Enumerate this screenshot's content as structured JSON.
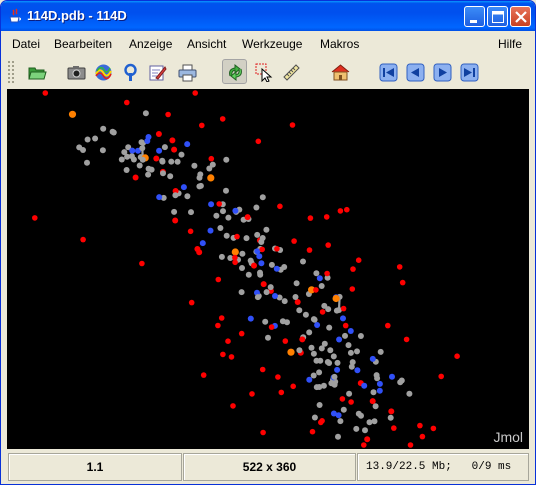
{
  "window": {
    "title": "114D.pdb - 114D",
    "controls": [
      "minimize",
      "maximize",
      "close"
    ]
  },
  "menubar": {
    "items": [
      {
        "label": "Datei"
      },
      {
        "label": "Bearbeiten"
      },
      {
        "label": "Anzeige"
      },
      {
        "label": "Ansicht"
      },
      {
        "label": "Werkzeuge"
      },
      {
        "label": "Makros"
      },
      {
        "label": "Hilfe"
      }
    ]
  },
  "toolbar": {
    "tools": [
      {
        "icon": "open-folder-icon"
      },
      {
        "icon": "camera-icon"
      },
      {
        "icon": "movie-icon"
      },
      {
        "icon": "script-icon"
      },
      {
        "icon": "edit-icon"
      },
      {
        "icon": "print-icon"
      },
      {
        "icon": "rotate-icon",
        "active": true
      },
      {
        "icon": "pick-icon"
      },
      {
        "icon": "measure-icon"
      },
      {
        "icon": "home-icon"
      },
      {
        "icon": "first-frame-icon"
      },
      {
        "icon": "previous-frame-icon"
      },
      {
        "icon": "next-frame-icon"
      },
      {
        "icon": "last-frame-icon"
      }
    ]
  },
  "viewer": {
    "watermark": "Jmol",
    "background": "#000000"
  },
  "status": {
    "frame": "1.1",
    "dimensions": "522 x 360",
    "memory": "13.9/22.5 Mb;",
    "timing": "0/9 ms"
  },
  "colors": {
    "carbon": "#A0A0A0",
    "oxygen": "#FF0000",
    "nitrogen": "#3050F8",
    "phosphorus": "#FF8000"
  }
}
